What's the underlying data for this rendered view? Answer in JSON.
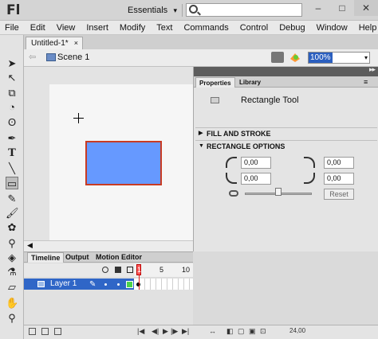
{
  "app": {
    "logo": "Fl"
  },
  "titlebar": {
    "workspace": "Essentials",
    "search_placeholder": "",
    "min": "–",
    "max": "□",
    "close": "✕"
  },
  "menus": [
    "File",
    "Edit",
    "View",
    "Insert",
    "Modify",
    "Text",
    "Commands",
    "Control",
    "Debug",
    "Window",
    "Help"
  ],
  "document": {
    "tab_label": "Untitled-1*",
    "close": "×"
  },
  "editbar": {
    "scene": "Scene 1",
    "zoom": "100%"
  },
  "properties": {
    "tabs": [
      "Properties",
      "Library"
    ],
    "tool_name": "Rectangle Tool",
    "sections": [
      "FILL AND STROKE",
      "RECTANGLE OPTIONS"
    ],
    "corner_values": [
      "0,00",
      "0,00",
      "0,00",
      "0,00"
    ],
    "reset_label": "Reset"
  },
  "timeline": {
    "tabs": [
      "Timeline",
      "Output",
      "Motion Editor"
    ],
    "frame_numbers": [
      "1",
      "5",
      "10"
    ],
    "layer_name": "Layer 1",
    "fps": "24,00"
  }
}
